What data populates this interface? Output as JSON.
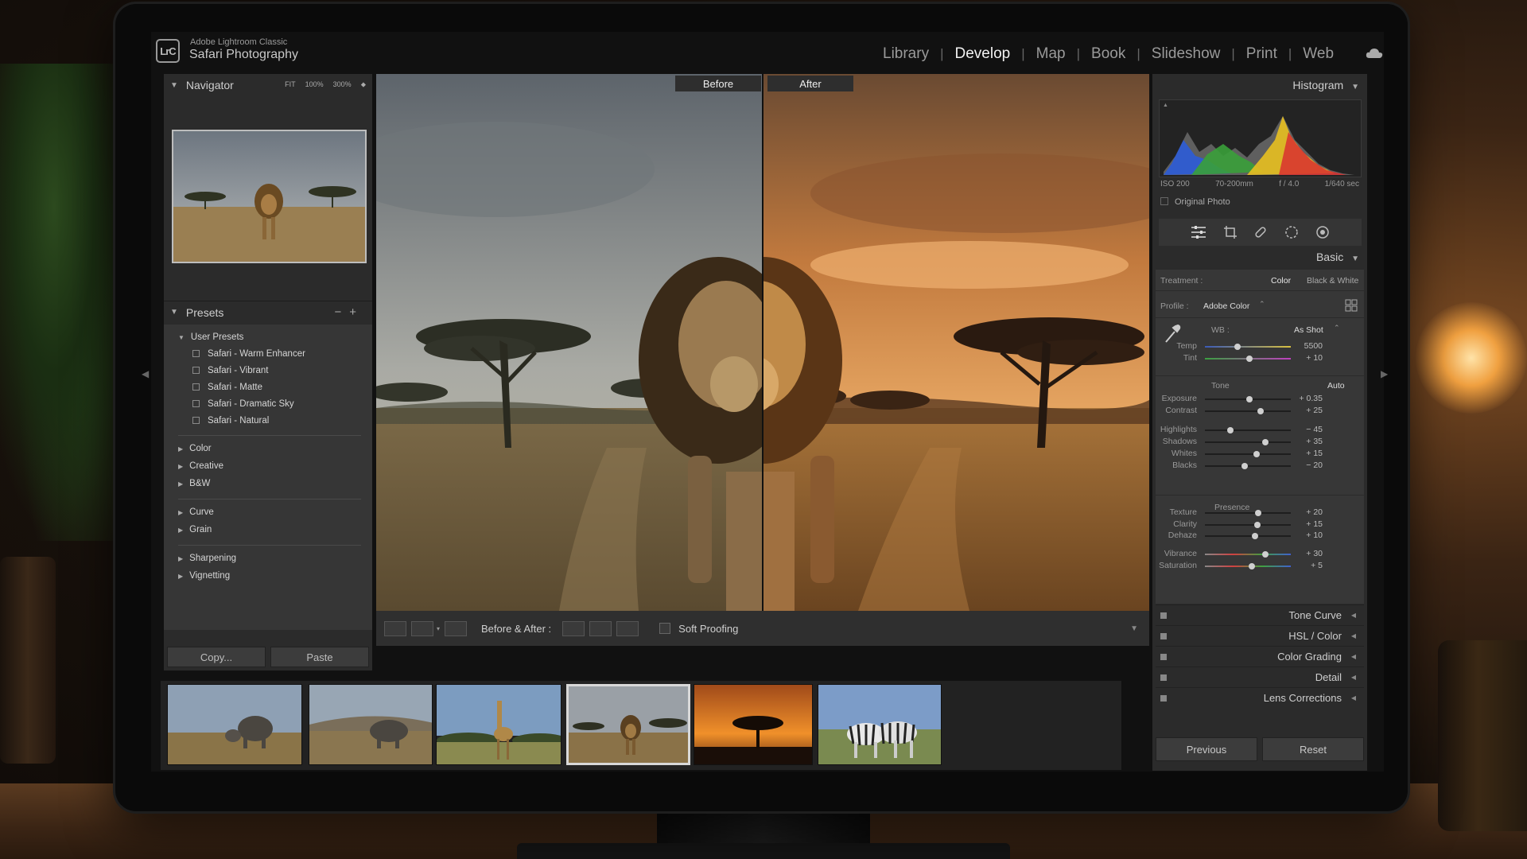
{
  "app": {
    "name": "Adobe Lightroom Classic",
    "catalog": "Safari Photography",
    "logo": "LrC"
  },
  "modules": [
    "Library",
    "Develop",
    "Map",
    "Book",
    "Slideshow",
    "Print",
    "Web"
  ],
  "active_module": "Develop",
  "left_panel": {
    "navigator": {
      "title": "Navigator",
      "zoom": [
        "FIT",
        "100%",
        "300%"
      ]
    },
    "presets": {
      "title": "Presets",
      "groups": [
        {
          "label": "User Presets",
          "expanded": true,
          "items": [
            "Safari - Warm Enhancer",
            "Safari - Vibrant",
            "Safari - Matte",
            "Safari - Dramatic Sky",
            "Safari - Natural"
          ]
        },
        {
          "label": "Color"
        },
        {
          "label": "Creative"
        },
        {
          "label": "B&W"
        },
        {
          "label": "Curve"
        },
        {
          "label": "Grain"
        },
        {
          "label": "Sharpening"
        },
        {
          "label": "Vignetting"
        }
      ]
    },
    "copy": "Copy...",
    "paste": "Paste"
  },
  "center": {
    "before_label": "Before",
    "after_label": "After",
    "toolbar": {
      "before_after": "Before & After :",
      "soft_proofing": "Soft Proofing"
    }
  },
  "filmstrip": {
    "count": 6,
    "selected_index": 3
  },
  "right_panel": {
    "histogram": {
      "title": "Histogram",
      "iso": "ISO 200",
      "lens": "70-200mm",
      "aperture": "f / 4.0",
      "shutter": "1/640 sec",
      "original_photo": "Original Photo"
    },
    "basic": {
      "title": "Basic",
      "treatment_label": "Treatment :",
      "treatment_color": "Color",
      "treatment_bw": "Black & White",
      "profile_label": "Profile :",
      "profile_value": "Adobe Color",
      "wb_label": "WB :",
      "wb_value": "As Shot",
      "tone_label": "Tone",
      "auto_label": "Auto",
      "presence_label": "Presence",
      "sliders": [
        {
          "label": "Temp",
          "value": "5500",
          "pos": 0.38
        },
        {
          "label": "Tint",
          "value": "+ 10",
          "pos": 0.52
        },
        {
          "label": "Exposure",
          "value": "+ 0.35",
          "pos": 0.52
        },
        {
          "label": "Contrast",
          "value": "+ 25",
          "pos": 0.65
        },
        {
          "label": "Highlights",
          "value": "− 45",
          "pos": 0.3
        },
        {
          "label": "Shadows",
          "value": "+ 35",
          "pos": 0.7
        },
        {
          "label": "Whites",
          "value": "+ 15",
          "pos": 0.6
        },
        {
          "label": "Blacks",
          "value": "− 20",
          "pos": 0.46
        },
        {
          "label": "Texture",
          "value": "+ 20",
          "pos": 0.62
        },
        {
          "label": "Clarity",
          "value": "+ 15",
          "pos": 0.61
        },
        {
          "label": "Dehaze",
          "value": "+ 10",
          "pos": 0.58
        },
        {
          "label": "Vibrance",
          "value": "+ 30",
          "pos": 0.7
        },
        {
          "label": "Saturation",
          "value": "+ 5",
          "pos": 0.55
        }
      ]
    },
    "panels": [
      "Tone Curve",
      "HSL / Color",
      "Color Grading",
      "Detail",
      "Lens Corrections"
    ],
    "previous": "Previous",
    "reset": "Reset"
  },
  "colors": {
    "ui_bg": "#2b2b2b",
    "panel_inner": "#373737",
    "active_module": "#f2f2f2",
    "sunset": "#e08a3a"
  }
}
